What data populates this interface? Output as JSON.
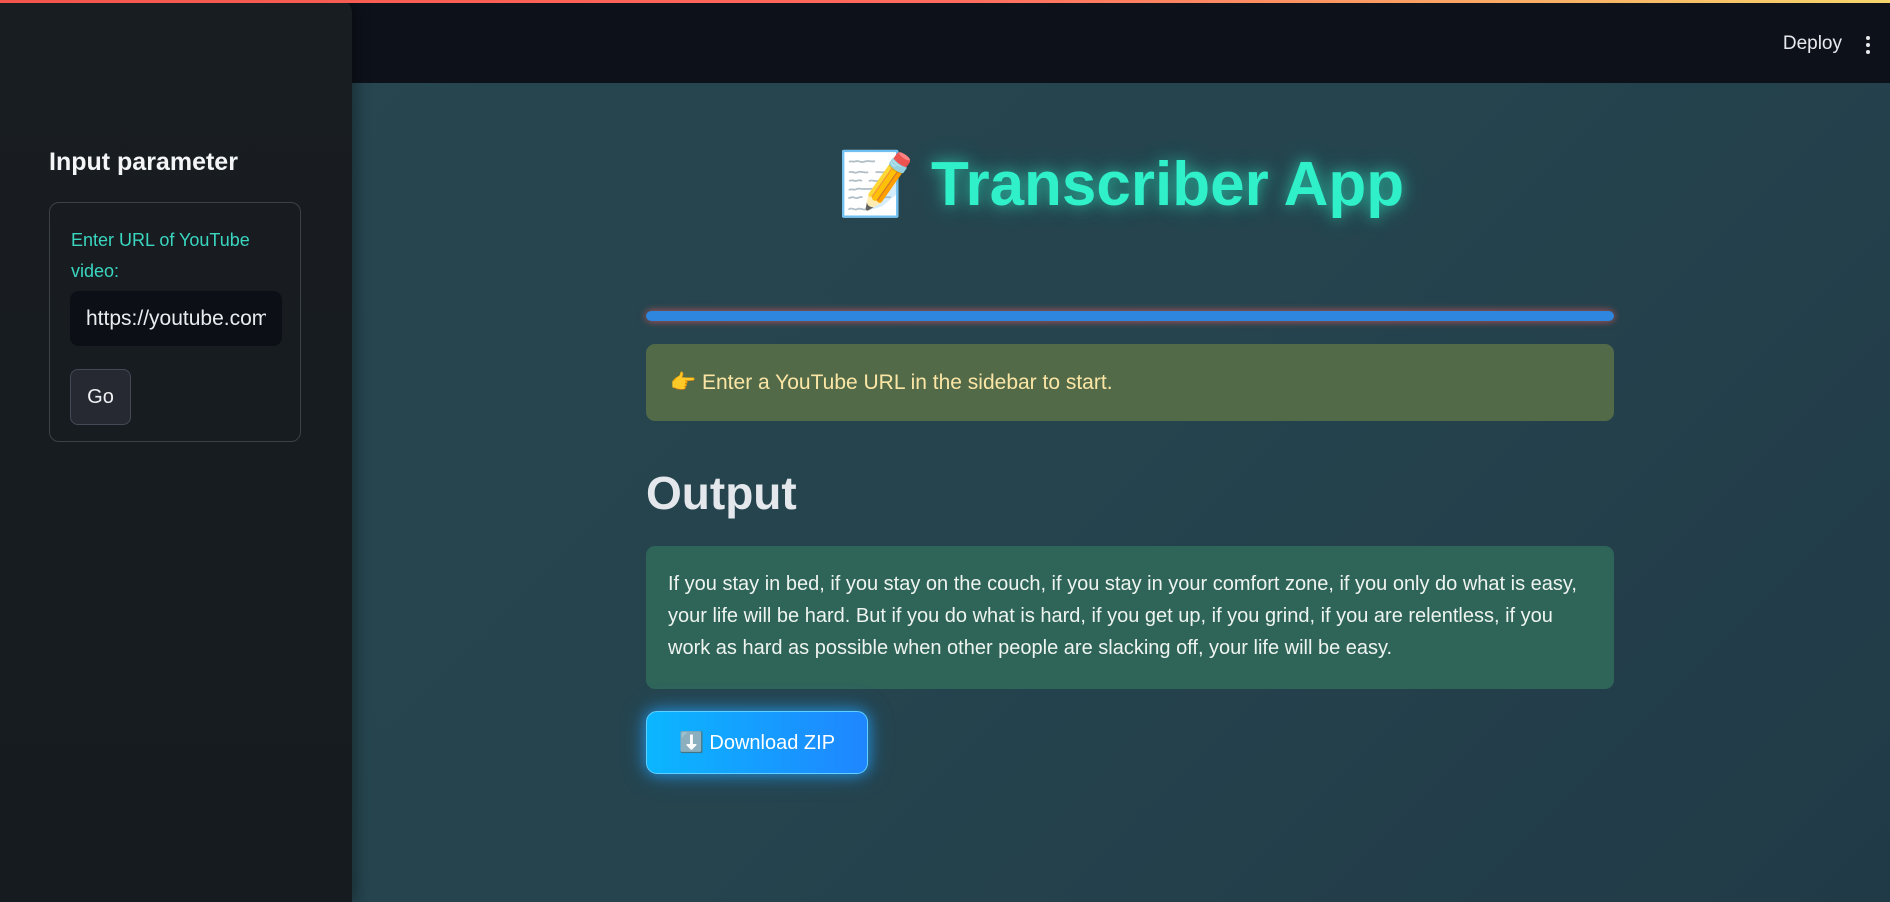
{
  "header": {
    "deploy_label": "Deploy",
    "menu_icon": "more-vertical-icon"
  },
  "sidebar": {
    "title": "Input parameter",
    "url_field_label": "Enter URL of YouTube video:",
    "url_value": "https://youtube.com",
    "go_label": "Go"
  },
  "main": {
    "title_emoji": "📝",
    "title_text": "Transcriber App",
    "progress_fraction": 1.0,
    "info_emoji": "👉",
    "info_text": "Enter a YouTube URL in the sidebar to start.",
    "output_heading": "Output",
    "output_text": "If you stay in bed, if you stay on the couch, if you stay in your comfort zone, if you only do what is easy, your life will be hard. But if you do what is hard, if you get up, if you grind, if you are relentless, if you work as hard as possible when other people are slacking off, your life will be easy.",
    "download_emoji": "⬇️",
    "download_label": "Download ZIP"
  },
  "colors": {
    "accent": "#2ff0c9",
    "progress": "#2e86de",
    "info_bg": "#536a49",
    "output_bg": "#2f6459",
    "download_start": "#0bb6ff",
    "download_end": "#1f86ff"
  }
}
